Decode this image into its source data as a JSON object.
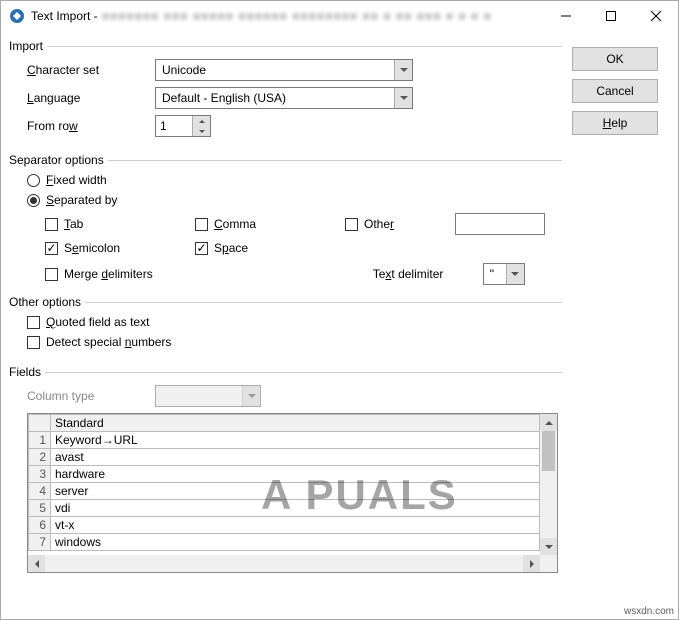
{
  "window": {
    "title": "Text Import -",
    "blurred": "■■■■■■■ ■■■ ■■■■■ ■■■■■■ ■■■■■■■■ ■■ ■ ■■ ■■■ ■ ■ ■ ■"
  },
  "buttons": {
    "ok": "OK",
    "cancel": "Cancel",
    "help": "Help"
  },
  "import": {
    "legend": "Import",
    "charset_label": "Character set",
    "charset_value": "Unicode",
    "language_label": "Language",
    "language_value": "Default - English (USA)",
    "fromrow_label": "From row",
    "fromrow_value": "1"
  },
  "separator": {
    "legend": "Separator options",
    "fixed": {
      "label": "Fixed width",
      "checked": false
    },
    "separated": {
      "label": "Separated by",
      "checked": true
    },
    "tab": {
      "label": "Tab",
      "checked": false
    },
    "comma": {
      "label": "Comma",
      "checked": false
    },
    "other": {
      "label": "Other",
      "checked": false,
      "value": ""
    },
    "semicolon": {
      "label": "Semicolon",
      "checked": true
    },
    "space": {
      "label": "Space",
      "checked": true
    },
    "merge": {
      "label": "Merge delimiters",
      "checked": false
    },
    "textdelim_label": "Text delimiter",
    "textdelim_value": "\""
  },
  "other": {
    "legend": "Other options",
    "quoted": {
      "label": "Quoted field as text",
      "checked": false
    },
    "detect": {
      "label": "Detect special numbers",
      "checked": false
    }
  },
  "fields": {
    "legend": "Fields",
    "coltype_label": "Column type",
    "header": "Standard",
    "rows": [
      "Keyword→URL",
      "avast",
      "hardware",
      "server",
      "vdi",
      "vt-x",
      "windows"
    ]
  },
  "watermark": "A   PUALS",
  "credit": "wsxdn.com"
}
